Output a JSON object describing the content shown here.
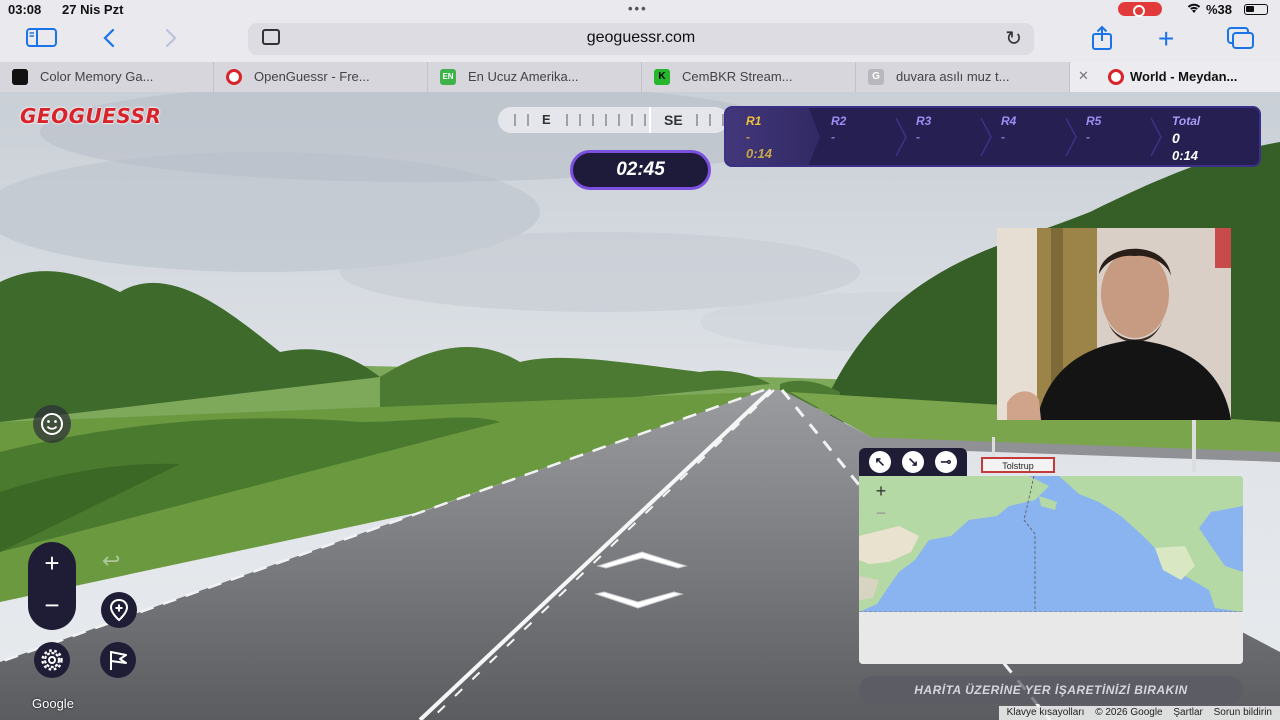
{
  "status_bar": {
    "time": "03:08",
    "date": "27 Nis Pzt",
    "battery": "%38"
  },
  "browser": {
    "url": "geoguessr.com",
    "tabs": [
      {
        "title": "Color Memory Ga...",
        "favicon_color": "#111111",
        "favicon_text": ""
      },
      {
        "title": "OpenGuessr - Fre...",
        "favicon_color": "#d8232a",
        "favicon_text": ""
      },
      {
        "title": "En Ucuz Amerika...",
        "favicon_color": "#3db34a",
        "favicon_text": "EN"
      },
      {
        "title": "CemBKR Stream...",
        "favicon_color": "#28b62c",
        "favicon_text": "K"
      },
      {
        "title": "duvara asılı muz t...",
        "favicon_color": "#b8b8bc",
        "favicon_text": "G"
      },
      {
        "title": "World - Meydan...",
        "favicon_color": "#d8232a",
        "favicon_text": ""
      }
    ]
  },
  "game": {
    "logo": "GEOGUESSR",
    "compass": {
      "labels": [
        "E",
        "SE"
      ]
    },
    "timer": "02:45",
    "rounds": [
      {
        "label": "R1",
        "value": "-",
        "time": "0:14",
        "active": true
      },
      {
        "label": "R2",
        "value": "-",
        "time": "",
        "active": false
      },
      {
        "label": "R3",
        "value": "-",
        "time": "",
        "active": false
      },
      {
        "label": "R4",
        "value": "-",
        "time": "",
        "active": false
      },
      {
        "label": "R5",
        "value": "-",
        "time": "",
        "active": false
      }
    ],
    "total": {
      "label": "Total",
      "value": "0",
      "time": "0:14"
    },
    "road_sign": "Tolstrup",
    "guess_button": "HARİTA ÜZERİNE YER İŞARETİNİZİ BIRAKIN",
    "google_brand": "Google",
    "attribution": [
      "Klavye kısayolları",
      "© 2026 Google",
      "Şartlar",
      "Sorun bildirin"
    ]
  },
  "colors": {
    "accent": "#7b4fe0",
    "panel": "#251f52",
    "active_round": "#f0c23a",
    "brand_red": "#d8232a"
  }
}
